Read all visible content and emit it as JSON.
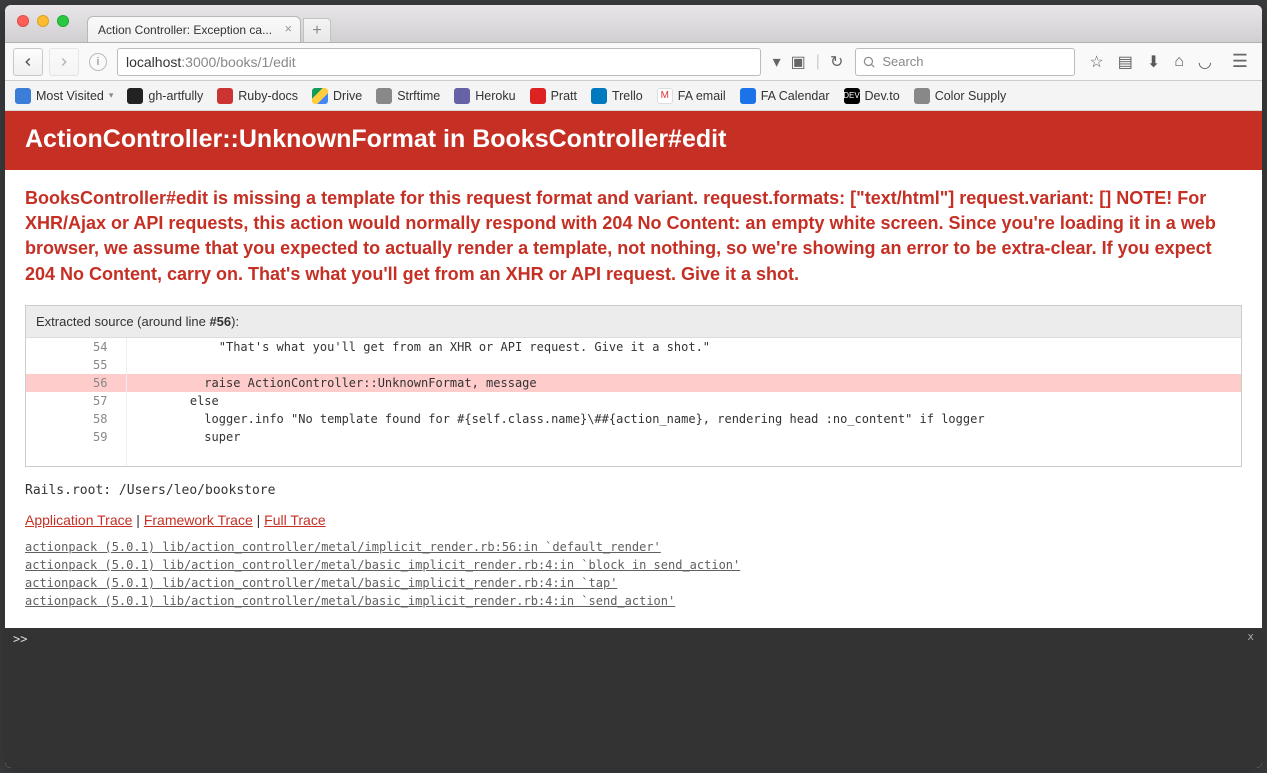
{
  "tab": {
    "title": "Action Controller: Exception ca..."
  },
  "url": {
    "host": "localhost",
    "rest": ":3000/books/1/edit"
  },
  "search": {
    "placeholder": "Search"
  },
  "bookmarks": [
    {
      "label": "Most Visited",
      "icon": "bm-blue",
      "drop": true
    },
    {
      "label": "gh-artfully",
      "icon": "bm-gh"
    },
    {
      "label": "Ruby-docs",
      "icon": "bm-red"
    },
    {
      "label": "Drive",
      "icon": "bm-drive"
    },
    {
      "label": "Strftime",
      "icon": "bm-globe"
    },
    {
      "label": "Heroku",
      "icon": "bm-heroku"
    },
    {
      "label": "Pratt",
      "icon": "bm-pratt"
    },
    {
      "label": "Trello",
      "icon": "bm-trello"
    },
    {
      "label": "FA email",
      "icon": "bm-gmail"
    },
    {
      "label": "FA Calendar",
      "icon": "bm-cal"
    },
    {
      "label": "Dev.to",
      "icon": "bm-dev"
    },
    {
      "label": "Color Supply",
      "icon": "bm-sup"
    }
  ],
  "error": {
    "title": "ActionController::UnknownFormat in BooksController#edit",
    "message": "BooksController#edit is missing a template for this request format and variant. request.formats: [\"text/html\"] request.variant: [] NOTE! For XHR/Ajax or API requests, this action would normally respond with 204 No Content: an empty white screen. Since you're loading it in a web browser, we assume that you expected to actually render a template, not nothing, so we're showing an error to be extra-clear. If you expect 204 No Content, carry on. That's what you'll get from an XHR or API request. Give it a shot."
  },
  "source": {
    "label_pre": "Extracted source (around line ",
    "line_num": "#56",
    "label_post": "):",
    "lines": [
      {
        "n": "54",
        "c": "          \"That's what you'll get from an XHR or API request. Give it a shot.\""
      },
      {
        "n": "55",
        "c": ""
      },
      {
        "n": "56",
        "c": "        raise ActionController::UnknownFormat, message",
        "hl": true
      },
      {
        "n": "57",
        "c": "      else"
      },
      {
        "n": "58",
        "c": "        logger.info \"No template found for #{self.class.name}\\##{action_name}, rendering head :no_content\" if logger"
      },
      {
        "n": "59",
        "c": "        super"
      }
    ]
  },
  "rails_root": "Rails.root: /Users/leo/bookstore",
  "trace_tabs": {
    "a": "Application Trace",
    "b": "Framework Trace",
    "c": "Full Trace",
    "sep": " | "
  },
  "traces": [
    "actionpack (5.0.1) lib/action_controller/metal/implicit_render.rb:56:in `default_render'",
    "actionpack (5.0.1) lib/action_controller/metal/basic_implicit_render.rb:4:in `block in send_action'",
    "actionpack (5.0.1) lib/action_controller/metal/basic_implicit_render.rb:4:in `tap'",
    "actionpack (5.0.1) lib/action_controller/metal/basic_implicit_render.rb:4:in `send_action'"
  ],
  "console": {
    "prompt": ">>",
    "close": "x"
  }
}
